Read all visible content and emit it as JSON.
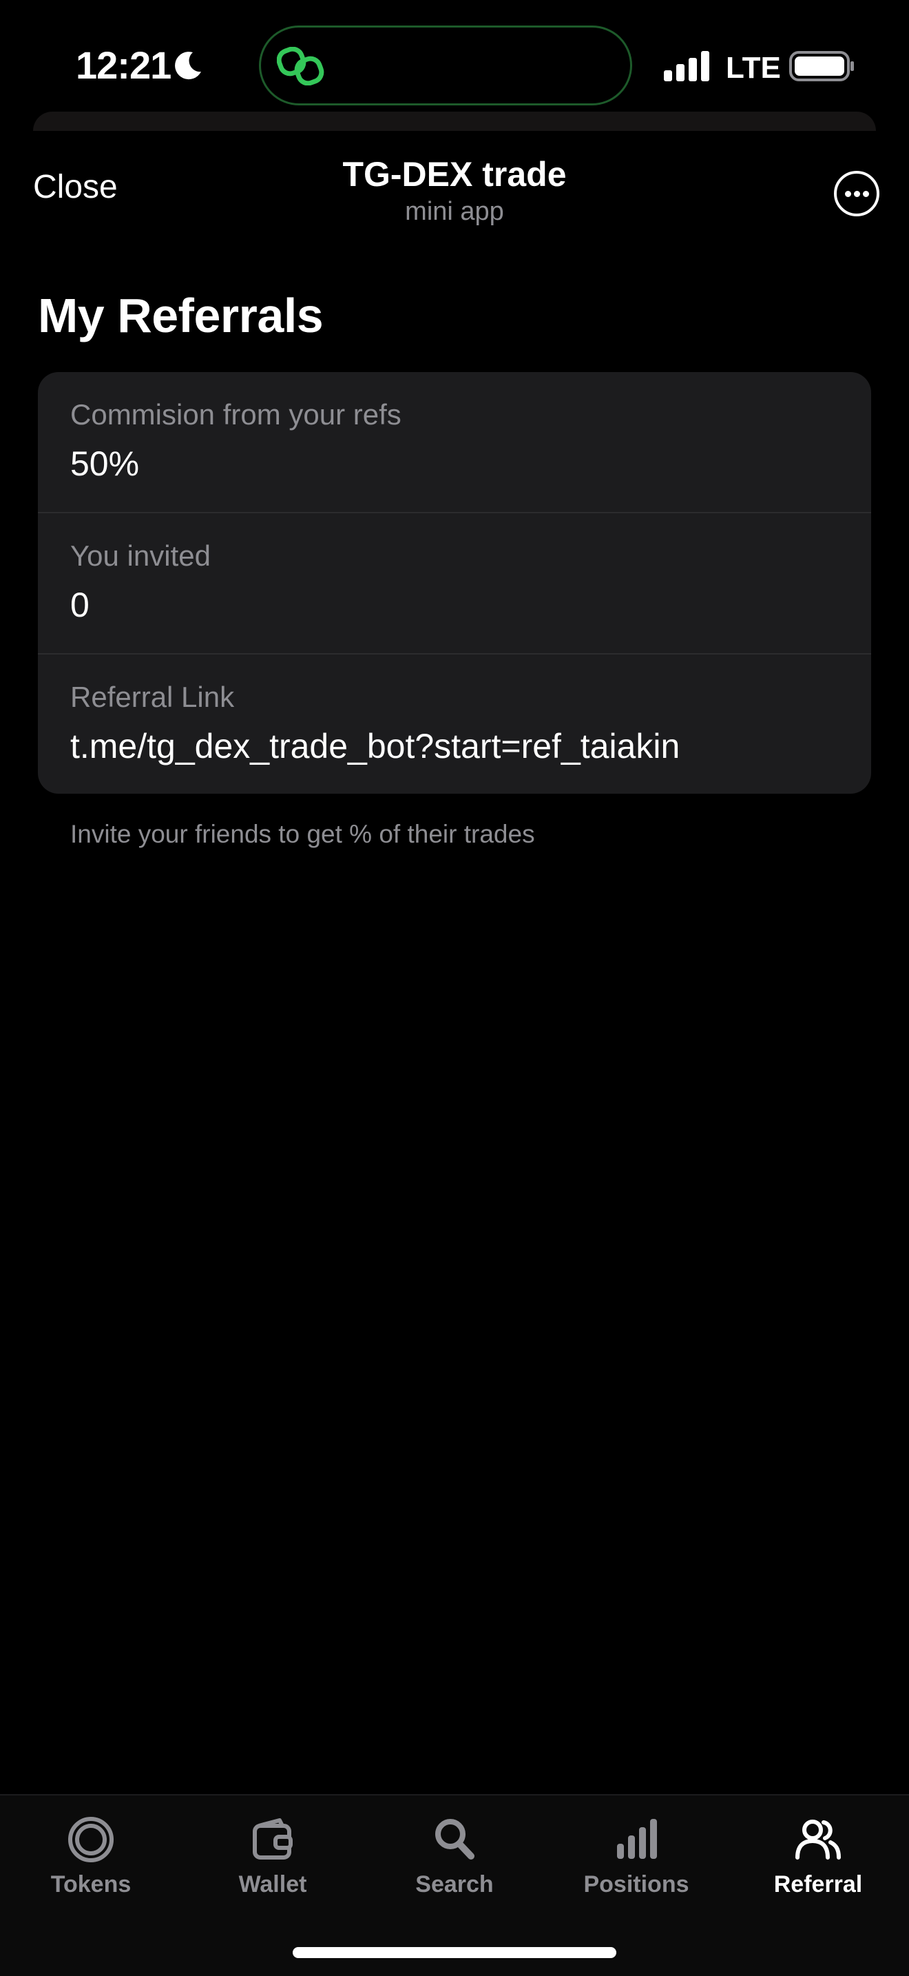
{
  "status_bar": {
    "time": "12:21",
    "network": "LTE",
    "icons": [
      "moon-icon",
      "link-icon",
      "signal-icon",
      "battery-icon"
    ]
  },
  "header": {
    "close_label": "Close",
    "title": "TG-DEX trade",
    "subtitle": "mini app",
    "more_icon": "ellipsis-circle-icon"
  },
  "main": {
    "title": "My Referrals",
    "rows": [
      {
        "label": "Commision from your refs",
        "value": "50%"
      },
      {
        "label": "You invited",
        "value": "0"
      },
      {
        "label": "Referral Link",
        "value": "t.me/tg_dex_trade_bot?start=ref_taiakin"
      }
    ],
    "helper_text": "Invite your friends to get % of their trades"
  },
  "tab_bar": {
    "active": "Referral",
    "tabs": [
      {
        "label": "Tokens",
        "icon": "tokens-icon"
      },
      {
        "label": "Wallet",
        "icon": "wallet-icon"
      },
      {
        "label": "Search",
        "icon": "search-icon"
      },
      {
        "label": "Positions",
        "icon": "positions-icon"
      },
      {
        "label": "Referral",
        "icon": "referral-icon"
      }
    ]
  },
  "colors": {
    "background": "#000000",
    "card": "#1c1c1e",
    "secondary_text": "#8e8e93",
    "accent_green": "#34c759"
  }
}
